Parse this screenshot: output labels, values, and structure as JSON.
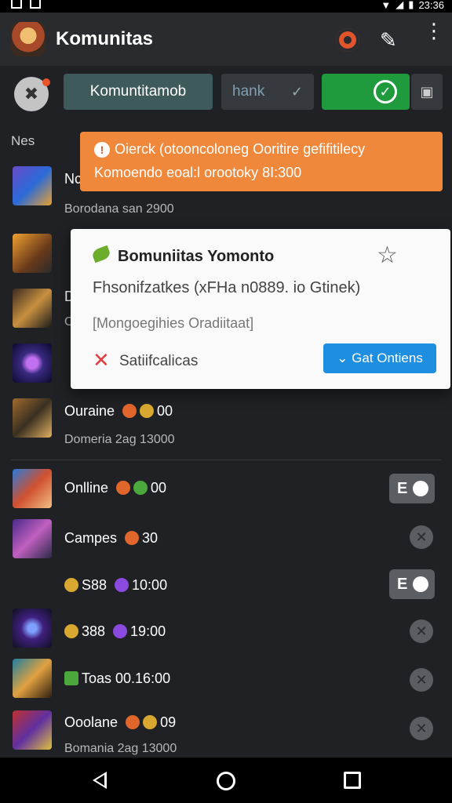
{
  "status_bar": {
    "time": "23:36"
  },
  "app_bar": {
    "title": "Komunitas"
  },
  "filter": {
    "avatar_glyph": "✖",
    "community_button": "Komuntitamob",
    "thank_button": "hank",
    "thank_check": "✓",
    "square_glyph": "▣"
  },
  "list": {
    "section_label": "Nes",
    "rows": [
      {
        "title": "Nc",
        "sub": "Borodana san 2900"
      },
      {
        "title": "",
        "sub": ""
      },
      {
        "title": "D",
        "sub": "O"
      },
      {
        "title": "",
        "sub": ""
      },
      {
        "title": "Ouraine",
        "value": "00",
        "sub": "Domeria 2ag ",
        "sub_value": "13000"
      },
      {
        "title": "Onlline",
        "value": "00",
        "toggle": "E"
      },
      {
        "title": "Campes",
        "value": "30"
      },
      {
        "title": "S88",
        "value": "10:00",
        "toggle": "E"
      },
      {
        "title": "388",
        "value": "19:00"
      },
      {
        "title": "Toas 00.16:00"
      },
      {
        "title": "Ooolane",
        "value": "09",
        "sub": "Bomania 2ag ",
        "sub_value": "13000"
      }
    ]
  },
  "banner": {
    "line1": "Oierck (otooncoloneg Ooritire gefifitilecy",
    "line2": "Komoendo eoal:l orootoky 8I:300"
  },
  "dialog": {
    "title": "Bomuniitas Yomonto",
    "line1": "Fhsonifzatkes (xFHa n0889. io Gtinek)",
    "line2": "[Mongoegihies Oradiitaat]",
    "action_label": "Satiifcalicas",
    "button_label": "⌄ Gat Ontiens"
  },
  "colors": {
    "accent_orange": "#f0883c",
    "accent_green": "#1f9a3c",
    "accent_blue": "#1e8ee0",
    "background": "#202124"
  }
}
